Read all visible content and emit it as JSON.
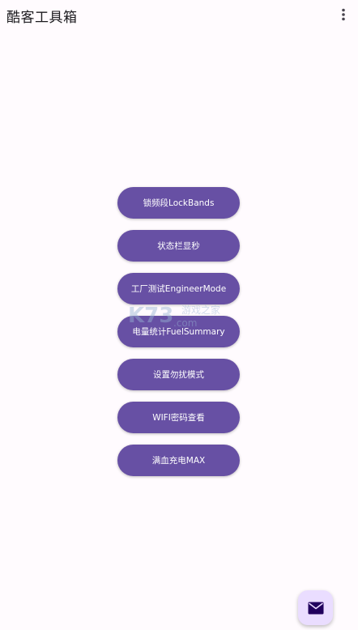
{
  "app_bar": {
    "title": "酷客工具箱",
    "menu_icon": "more-vert-icon"
  },
  "buttons": [
    {
      "label": "锁频段LockBands"
    },
    {
      "label": "状态栏显秒"
    },
    {
      "label": "工厂测试EngineerMode"
    },
    {
      "label": "电量统计FuelSummary"
    },
    {
      "label": "设置勿扰模式"
    },
    {
      "label": "WIFI密码查看"
    },
    {
      "label": "满血充电MAX"
    }
  ],
  "watermark": {
    "logo": "K73",
    "domain": ".com",
    "text": "游戏之家"
  },
  "fab": {
    "icon": "mail-icon"
  },
  "colors": {
    "primary": "#6750a4",
    "background": "#fffbfe",
    "fab": "#eaddff",
    "fab_icon": "#21005d"
  }
}
